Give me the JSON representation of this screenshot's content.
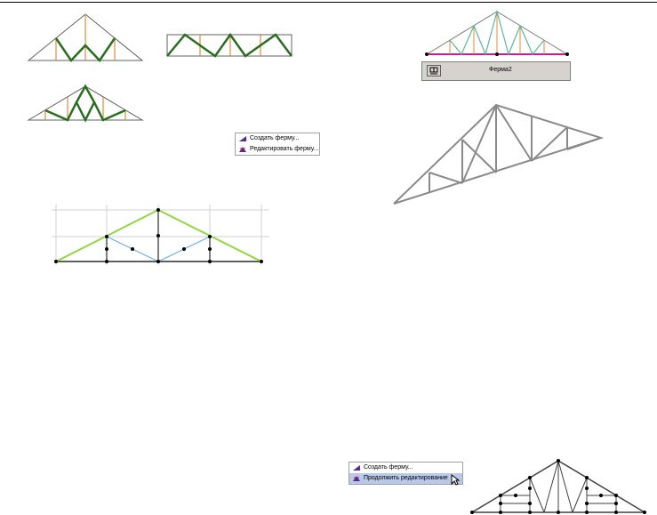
{
  "colors": {
    "chord": "#606060",
    "web_heavy": "#2a6e1f",
    "post": "#e08a3a",
    "web_teal": "#5ab89a",
    "bottom_magenta": "#c0208a",
    "top_green": "#90d840",
    "web_blue": "#68b0e0",
    "truss_gray": "#8a8a8a",
    "grid": "#d0d0d0"
  },
  "menu_top": {
    "items": [
      {
        "label": "Создать ферму...",
        "icon": "create-truss-icon"
      },
      {
        "label": "Редактировать ферму...",
        "icon": "edit-truss-icon"
      }
    ]
  },
  "toolbar": {
    "name": "Ферма2",
    "button_icon": "truss-tool-icon"
  },
  "menu_bottom": {
    "items": [
      {
        "label": "Создать ферму...",
        "icon": "create-truss-icon"
      },
      {
        "label": "Продолжить редактирование",
        "icon": "continue-edit-icon"
      }
    ],
    "active_index": 1
  }
}
